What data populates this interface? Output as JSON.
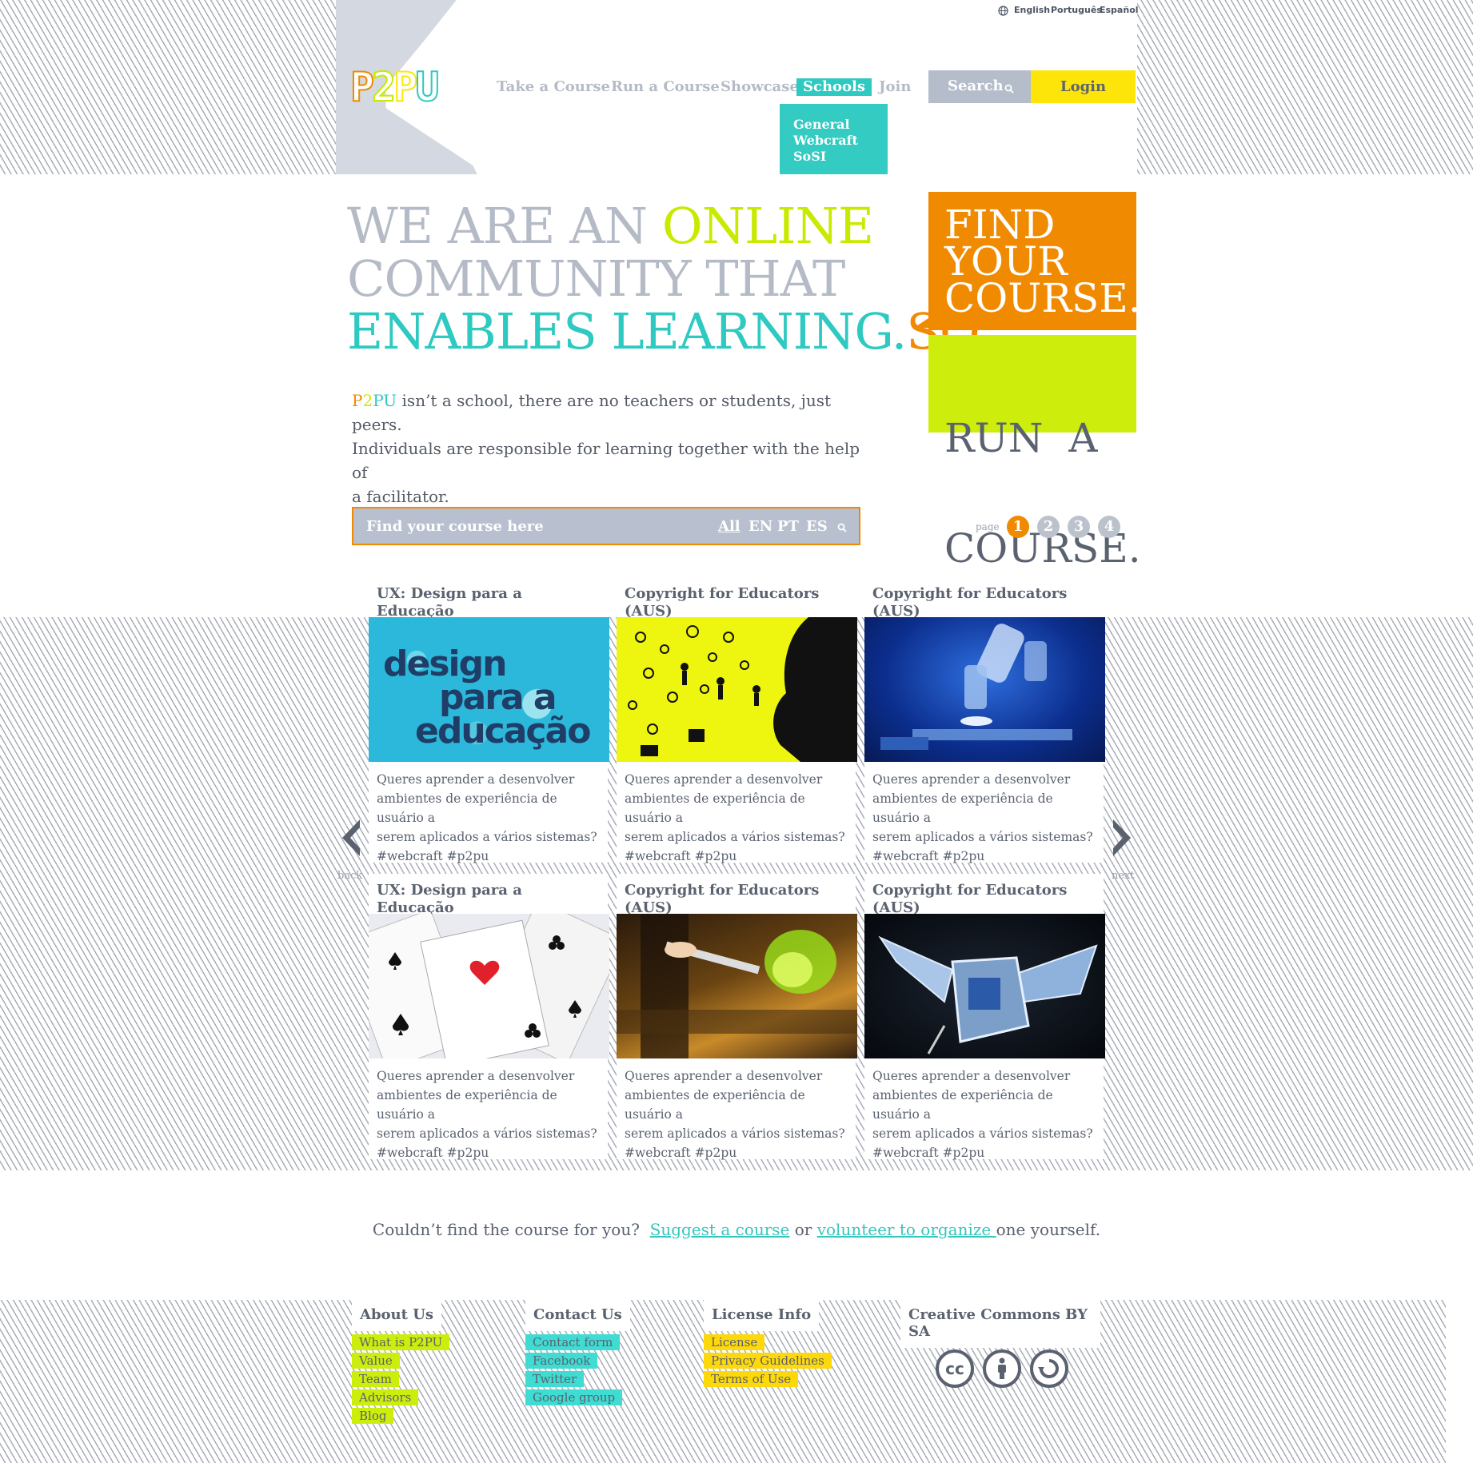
{
  "languages": [
    "English",
    "Português",
    "Español"
  ],
  "logo": {
    "letters": [
      "P",
      "2",
      "P",
      "U"
    ],
    "colors": [
      "#f08a00",
      "#c7ea00",
      "#fde50a",
      "#2ec9c1"
    ]
  },
  "nav": {
    "take_course": "Take a Course",
    "run_course": "Run a Course",
    "showcase": "Showcase",
    "schools": "Schools",
    "join": "Join",
    "search": "Search",
    "login": "Login",
    "schools_menu": [
      "General",
      "Webcraft",
      "SoSI"
    ]
  },
  "hero": {
    "line1_a": "WE ARE AN ",
    "line1_b": "ONLINE",
    "line2": "COMMUNITY THAT",
    "line3_a": "ENABLES LEARNING.",
    "line3_b": "SO",
    "intro_brand": "P2PU",
    "intro_line1": " isn’t a school, there are no teachers or students, just peers.",
    "intro_line2": "Individuals are responsible for learning together with the help of",
    "intro_line3": "a facilitator.",
    "find_box": [
      "FIND",
      "YOUR",
      "COURSE."
    ],
    "run_box": [
      "RUN  A",
      "COURSE."
    ]
  },
  "course_search": {
    "placeholder": "Find your course here",
    "filters": [
      "All",
      "EN",
      "PT",
      "ES"
    ],
    "page_label": "page",
    "pages": [
      "1",
      "2",
      "3",
      "4"
    ],
    "active_page": "1"
  },
  "carousel": {
    "back": "back",
    "next": "next"
  },
  "cards": [
    {
      "title": "UX: Design para a Educação",
      "image": "design-para-a-educacao",
      "image_text": [
        "design",
        "para a",
        "educação"
      ],
      "desc": [
        "Queres aprender a desenvolver",
        "ambientes de experiência de usuário a",
        "serem aplicados a vários sistemas?",
        "#webcraft #p2pu"
      ]
    },
    {
      "title": "Copyright for Educators (AUS)",
      "image": "copyright-silhouette",
      "desc": [
        "Queres aprender a desenvolver",
        "ambientes de experiência de usuário a",
        "serem aplicados a vários sistemas?",
        "#webcraft #p2pu"
      ]
    },
    {
      "title": "Copyright for Educators (AUS)",
      "image": "microscope",
      "desc": [
        "Queres aprender a desenvolver",
        "ambientes de experiência de usuário a",
        "serem aplicados a vários sistemas?",
        "#webcraft #p2pu"
      ]
    },
    {
      "title": "UX: Design para a Educação",
      "image": "playing-cards",
      "desc": [
        "Queres aprender a desenvolver",
        "ambientes de experiência de usuário a",
        "serem aplicados a vários sistemas?",
        "#webcraft #p2pu"
      ]
    },
    {
      "title": "Copyright for Educators (AUS)",
      "image": "cooking-flames",
      "desc": [
        "Queres aprender a desenvolver",
        "ambientes de experiência de usuário a",
        "serem aplicados a vários sistemas?",
        "#webcraft #p2pu"
      ]
    },
    {
      "title": "Copyright for Educators (AUS)",
      "image": "satellite",
      "desc": [
        "Queres aprender a desenvolver",
        "ambientes de experiência de usuário a",
        "serem aplicados a vários sistemas?",
        "#webcraft #p2pu"
      ]
    }
  ],
  "suggest": {
    "prefix": "Couldn’t find the course for you?  ",
    "link1": "Suggest a course",
    "middle": " or ",
    "link2": "volunteer to organize ",
    "suffix": "one yourself."
  },
  "footer": {
    "about": {
      "title": "About Us",
      "links": [
        "What is P2PU",
        "Value",
        "Team",
        "Advisors",
        "Blog"
      ],
      "color": "#cdee0c"
    },
    "contact": {
      "title": "Contact Us",
      "links": [
        "Contact form",
        "Facebook",
        "Twitter",
        "Google group"
      ],
      "color": "#3fdcd3"
    },
    "license": {
      "title": "License Info",
      "links": [
        "License",
        "Privacy Guidelines",
        "Terms of Use"
      ],
      "color": "#fde50a"
    },
    "cc": {
      "title": "Creative Commons BY SA",
      "icons": [
        "cc-icon",
        "by-icon",
        "sa-icon"
      ]
    }
  },
  "colors": {
    "orange": "#f08a00",
    "lime": "#cdee0c",
    "teal": "#2ec9c1",
    "yellow": "#fde50a",
    "grey": "#5a6270"
  }
}
